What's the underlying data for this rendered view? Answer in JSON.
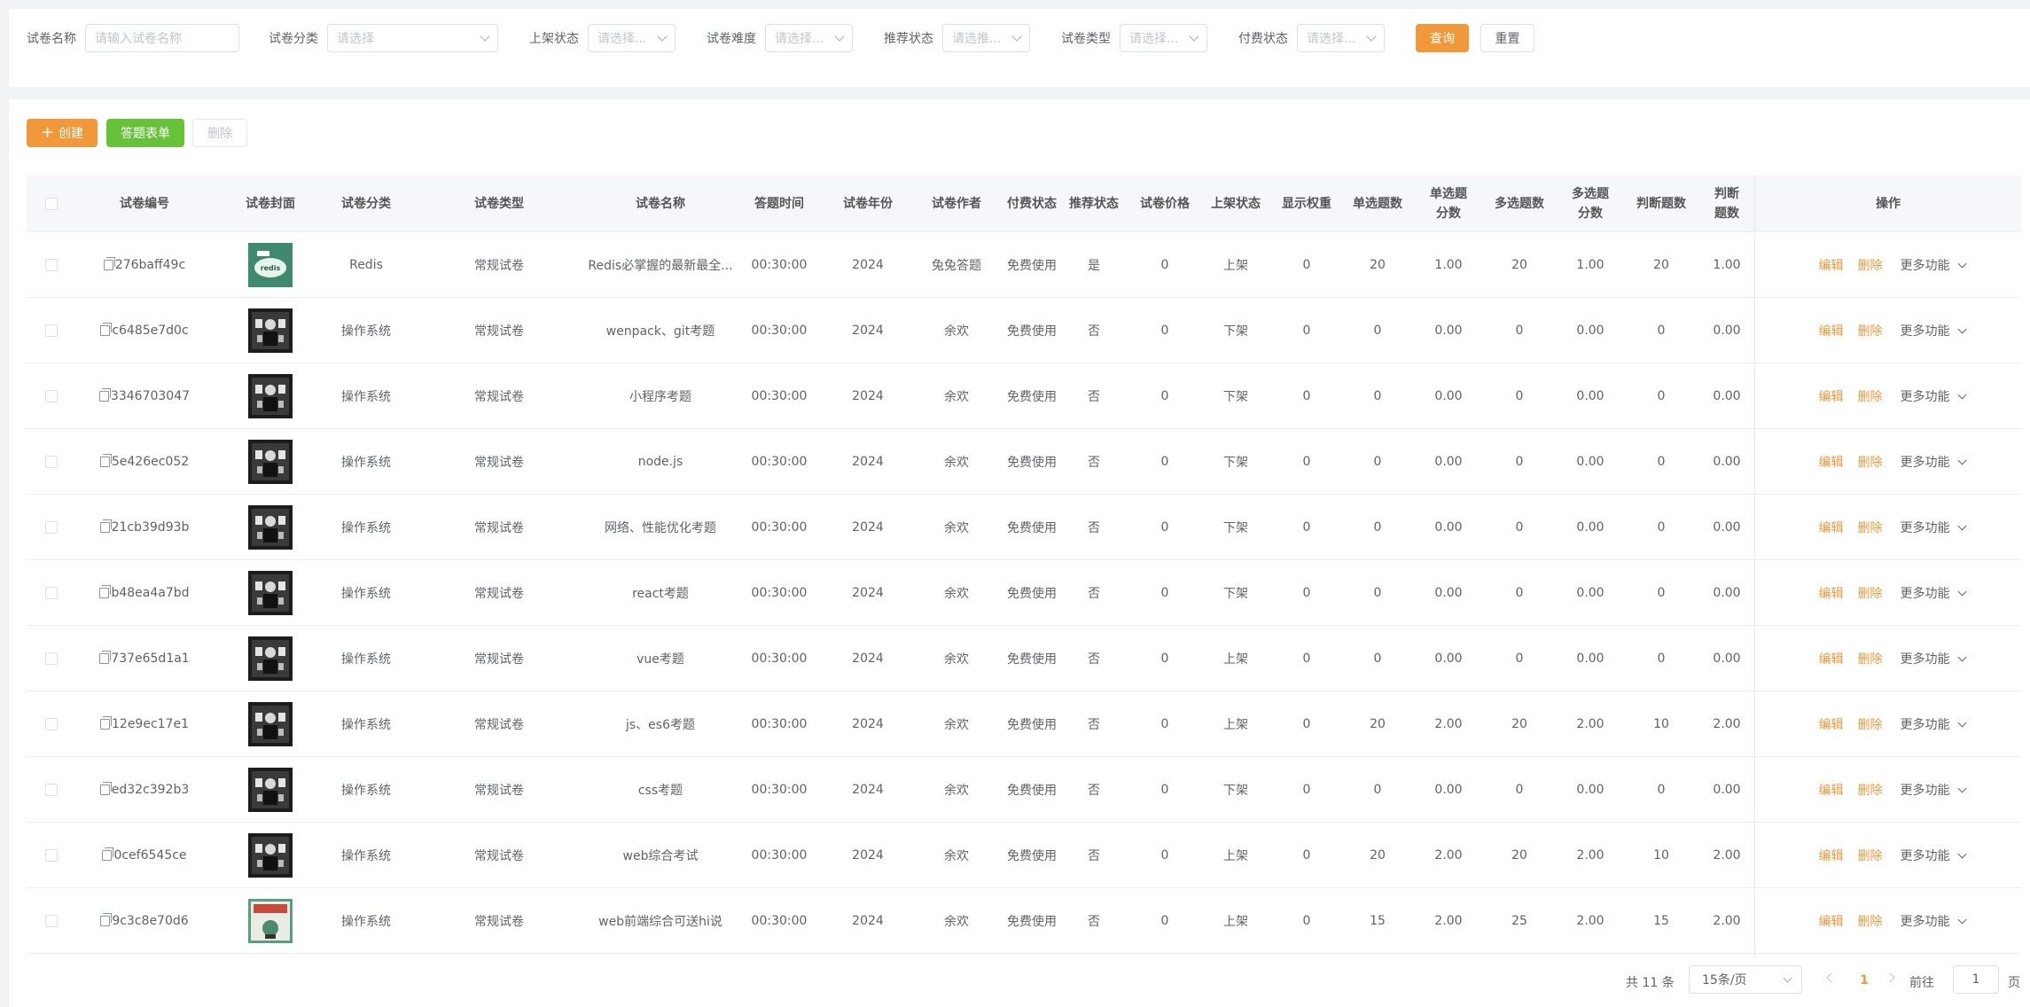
{
  "filters": [
    {
      "label": "试卷名称",
      "placeholder": "请输入试卷名称"
    },
    {
      "label": "试卷分类",
      "placeholder": "请选择"
    },
    {
      "label": "上架状态",
      "placeholder": "请选择..."
    },
    {
      "label": "试卷难度",
      "placeholder": "请选择..."
    },
    {
      "label": "推荐状态",
      "placeholder": "请选推..."
    },
    {
      "label": "试卷类型",
      "placeholder": "请选择..."
    },
    {
      "label": "付费状态",
      "placeholder": "请选择..."
    }
  ],
  "actions": {
    "query": "查询",
    "reset": "重置"
  },
  "toolbar": {
    "create": "创建",
    "answer_sheet": "答题表单",
    "delete": "删除"
  },
  "columns": [
    "试卷编号",
    "试卷封面",
    "试卷分类",
    "试卷类型",
    "试卷名称",
    "答题时间",
    "试卷年份",
    "试卷作者",
    "付费状态",
    "推荐状态",
    "试卷价格",
    "上架状态",
    "显示权重",
    "单选题数",
    "单选题分数",
    "多选题数",
    "多选题分数",
    "判断题数",
    "判断题数",
    "操作"
  ],
  "rows": [
    {
      "id": "276baff49c",
      "cover": "green",
      "category": "Redis",
      "type": "常规试卷",
      "name": "Redis必掌握的最新最全...",
      "time": "00:30:00",
      "year": "2024",
      "author": "兔兔答题",
      "pay": "免费使用",
      "recommend": "是",
      "price": "0",
      "status": "上架",
      "weight": "0",
      "single": "20",
      "single_score": "1.00",
      "multi": "20",
      "multi_score": "1.00",
      "judge": "20",
      "judge_score": "1.00"
    },
    {
      "id": "c6485e7d0c",
      "cover": "dark",
      "category": "操作系统",
      "type": "常规试卷",
      "name": "wenpack、git考题",
      "time": "00:30:00",
      "year": "2024",
      "author": "余欢",
      "pay": "免费使用",
      "recommend": "否",
      "price": "0",
      "status": "下架",
      "weight": "0",
      "single": "0",
      "single_score": "0.00",
      "multi": "0",
      "multi_score": "0.00",
      "judge": "0",
      "judge_score": "0.00"
    },
    {
      "id": "3346703047",
      "cover": "dark",
      "category": "操作系统",
      "type": "常规试卷",
      "name": "小程序考题",
      "time": "00:30:00",
      "year": "2024",
      "author": "余欢",
      "pay": "免费使用",
      "recommend": "否",
      "price": "0",
      "status": "下架",
      "weight": "0",
      "single": "0",
      "single_score": "0.00",
      "multi": "0",
      "multi_score": "0.00",
      "judge": "0",
      "judge_score": "0.00"
    },
    {
      "id": "5e426ec052",
      "cover": "dark",
      "category": "操作系统",
      "type": "常规试卷",
      "name": "node.js",
      "time": "00:30:00",
      "year": "2024",
      "author": "余欢",
      "pay": "免费使用",
      "recommend": "否",
      "price": "0",
      "status": "下架",
      "weight": "0",
      "single": "0",
      "single_score": "0.00",
      "multi": "0",
      "multi_score": "0.00",
      "judge": "0",
      "judge_score": "0.00"
    },
    {
      "id": "21cb39d93b",
      "cover": "dark",
      "category": "操作系统",
      "type": "常规试卷",
      "name": "网络、性能优化考题",
      "time": "00:30:00",
      "year": "2024",
      "author": "余欢",
      "pay": "免费使用",
      "recommend": "否",
      "price": "0",
      "status": "下架",
      "weight": "0",
      "single": "0",
      "single_score": "0.00",
      "multi": "0",
      "multi_score": "0.00",
      "judge": "0",
      "judge_score": "0.00"
    },
    {
      "id": "b48ea4a7bd",
      "cover": "dark",
      "category": "操作系统",
      "type": "常规试卷",
      "name": "react考题",
      "time": "00:30:00",
      "year": "2024",
      "author": "余欢",
      "pay": "免费使用",
      "recommend": "否",
      "price": "0",
      "status": "下架",
      "weight": "0",
      "single": "0",
      "single_score": "0.00",
      "multi": "0",
      "multi_score": "0.00",
      "judge": "0",
      "judge_score": "0.00"
    },
    {
      "id": "737e65d1a1",
      "cover": "dark",
      "category": "操作系统",
      "type": "常规试卷",
      "name": "vue考题",
      "time": "00:30:00",
      "year": "2024",
      "author": "余欢",
      "pay": "免费使用",
      "recommend": "否",
      "price": "0",
      "status": "上架",
      "weight": "0",
      "single": "0",
      "single_score": "0.00",
      "multi": "0",
      "multi_score": "0.00",
      "judge": "0",
      "judge_score": "0.00"
    },
    {
      "id": "12e9ec17e1",
      "cover": "dark",
      "category": "操作系统",
      "type": "常规试卷",
      "name": "js、es6考题",
      "time": "00:30:00",
      "year": "2024",
      "author": "余欢",
      "pay": "免费使用",
      "recommend": "否",
      "price": "0",
      "status": "上架",
      "weight": "0",
      "single": "20",
      "single_score": "2.00",
      "multi": "20",
      "multi_score": "2.00",
      "judge": "10",
      "judge_score": "2.00"
    },
    {
      "id": "ed32c392b3",
      "cover": "dark",
      "category": "操作系统",
      "type": "常规试卷",
      "name": "css考题",
      "time": "00:30:00",
      "year": "2024",
      "author": "余欢",
      "pay": "免费使用",
      "recommend": "否",
      "price": "0",
      "status": "下架",
      "weight": "0",
      "single": "0",
      "single_score": "0.00",
      "multi": "0",
      "multi_score": "0.00",
      "judge": "0",
      "judge_score": "0.00"
    },
    {
      "id": "0cef6545ce",
      "cover": "dark",
      "category": "操作系统",
      "type": "常规试卷",
      "name": "web综合考试",
      "time": "00:30:00",
      "year": "2024",
      "author": "余欢",
      "pay": "免费使用",
      "recommend": "否",
      "price": "0",
      "status": "上架",
      "weight": "0",
      "single": "20",
      "single_score": "2.00",
      "multi": "20",
      "multi_score": "2.00",
      "judge": "10",
      "judge_score": "2.00"
    },
    {
      "id": "9c3c8e70d6",
      "cover": "light",
      "category": "操作系统",
      "type": "常规试卷",
      "name": "web前端综合可送hi说",
      "time": "00:30:00",
      "year": "2024",
      "author": "余欢",
      "pay": "免费使用",
      "recommend": "否",
      "price": "0",
      "status": "上架",
      "weight": "0",
      "single": "15",
      "single_score": "2.00",
      "multi": "25",
      "multi_score": "2.00",
      "judge": "15",
      "judge_score": "2.00"
    }
  ],
  "row_actions": {
    "edit": "编辑",
    "delete": "删除",
    "more": "更多功能"
  },
  "pagination": {
    "total": "共 11 条",
    "page_size": "15条/页",
    "current": "1",
    "goto_label": "前往",
    "goto_value": "1",
    "page_suffix": "页"
  },
  "colors": {
    "accent": "#f0983a",
    "success": "#67c23a"
  }
}
